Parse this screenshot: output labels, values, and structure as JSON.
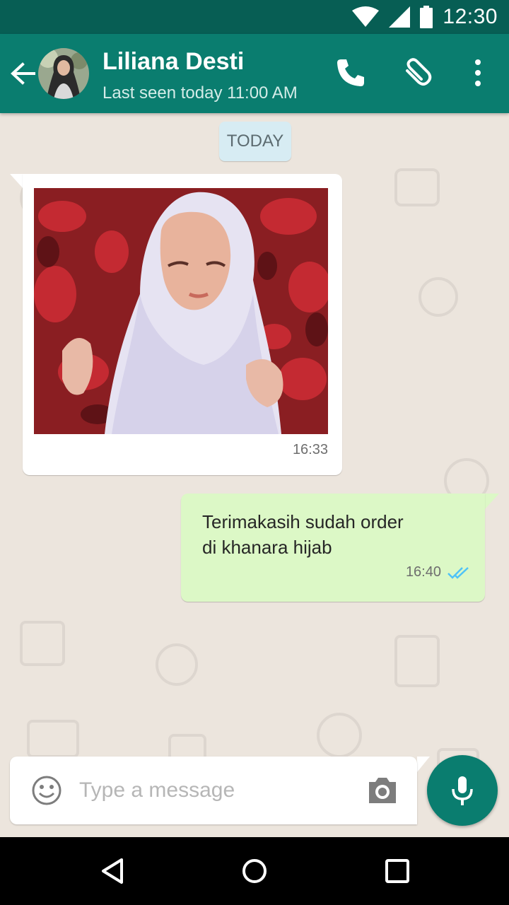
{
  "status_bar": {
    "time": "12:30",
    "icons": [
      "wifi-icon",
      "signal-icon",
      "battery-icon"
    ]
  },
  "header": {
    "contact_name": "Liliana Desti",
    "last_seen": "Last seen today 11:00 AM",
    "icons": [
      "back-arrow-icon",
      "phone-icon",
      "paperclip-icon",
      "more-vert-icon"
    ]
  },
  "chat": {
    "date_label": "TODAY",
    "messages": [
      {
        "direction": "incoming",
        "type": "image",
        "time": "16:33"
      },
      {
        "direction": "outgoing",
        "type": "text",
        "lines": [
          "Terimakasih sudah order",
          "di khanara hijab"
        ],
        "time": "16:40",
        "status": "read"
      }
    ]
  },
  "input": {
    "placeholder": "Type a message",
    "icons": [
      "emoji-icon",
      "camera-icon",
      "mic-icon"
    ]
  },
  "colors": {
    "header": "#0a7d6f",
    "status_bar": "#075e54",
    "chat_bg": "#ece5dd",
    "outgoing_bubble": "#dcf8c6",
    "date_chip": "#d7ecf3",
    "read_tick": "#4fc3f7"
  }
}
